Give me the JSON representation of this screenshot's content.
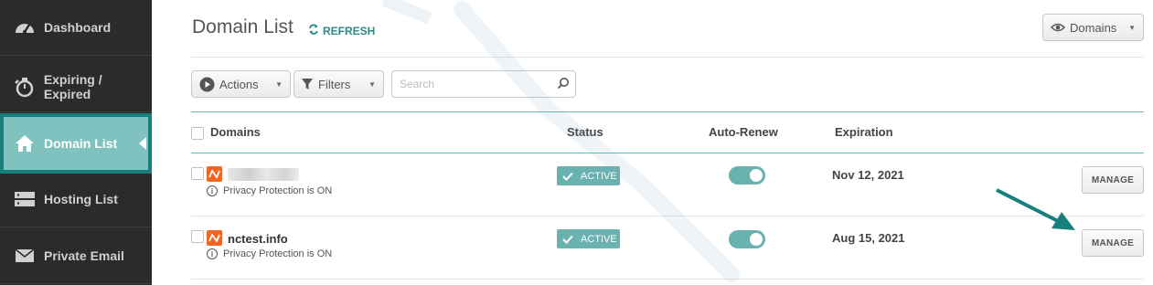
{
  "sidebar": {
    "items": [
      {
        "label": "Dashboard",
        "icon": "dashboard-gauge-icon"
      },
      {
        "label": "Expiring / Expired",
        "icon": "stopwatch-icon"
      },
      {
        "label": "Domain List",
        "icon": "home-icon",
        "active": true
      },
      {
        "label": "Hosting List",
        "icon": "server-icon"
      },
      {
        "label": "Private Email",
        "icon": "envelope-icon"
      }
    ]
  },
  "header": {
    "title": "Domain List",
    "refresh_label": "REFRESH",
    "view_dropdown": "Domains"
  },
  "toolbar": {
    "actions_label": "Actions",
    "filters_label": "Filters",
    "search_placeholder": "Search"
  },
  "table": {
    "columns": [
      "Domains",
      "Status",
      "Auto-Renew",
      "Expiration"
    ],
    "rows": [
      {
        "domain": "",
        "privacy": "Privacy Protection is ON",
        "status": "ACTIVE",
        "auto_renew": true,
        "expiration": "Nov 12, 2021",
        "action": "MANAGE"
      },
      {
        "domain": "nctest.info",
        "privacy": "Privacy Protection is ON",
        "status": "ACTIVE",
        "auto_renew": true,
        "expiration": "Aug 15, 2021",
        "action": "MANAGE"
      }
    ]
  },
  "colors": {
    "sidebar_bg": "#2b2b2b",
    "accent_teal": "#17807c",
    "status_teal": "#6ab2b0",
    "brand_orange": "#f26522"
  }
}
